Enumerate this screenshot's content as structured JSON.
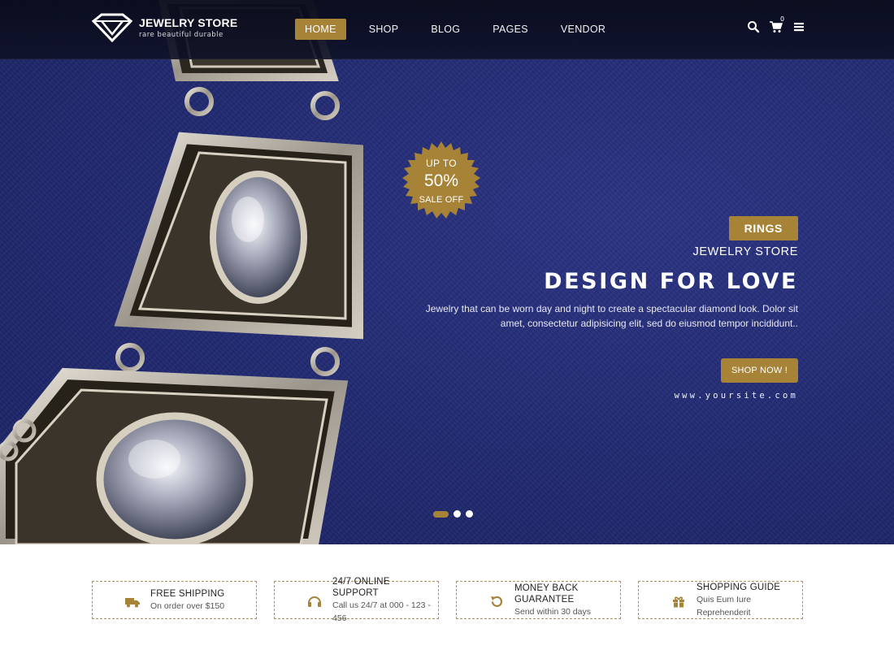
{
  "header": {
    "brand": "JEWELRY STORE",
    "tagline": "rare beautiful durable",
    "nav": [
      {
        "label": "HOME",
        "active": true
      },
      {
        "label": "SHOP",
        "active": false
      },
      {
        "label": "BLOG",
        "active": false
      },
      {
        "label": "PAGES",
        "active": false
      },
      {
        "label": "VENDOR",
        "active": false
      }
    ],
    "cart_count": "0",
    "icons": [
      "search-icon",
      "cart-icon",
      "menu-icon"
    ]
  },
  "hero": {
    "badge": {
      "line1": "UP TO",
      "line2": "50%",
      "line3": "SALE OFF"
    },
    "category_tag": "RINGS",
    "sub_brand": "JEWELRY STORE",
    "headline": "DESIGN FOR LOVE",
    "description_line1": "Jewelry that can be worn day and night to create a spectacular diamond look. Dolor sit",
    "description_line2": "amet, consectetur adipisicing elit, sed do eiusmod tempor incididunt..",
    "cta_label": "SHOP NOW !",
    "site_url": "www.yoursite.com",
    "slides": 3,
    "active_slide": 1
  },
  "features": [
    {
      "title": "FREE SHIPPING",
      "subtitle": "On order over $150",
      "icon": "truck-icon"
    },
    {
      "title": "24/7 ONLINE SUPPORT",
      "subtitle": "Call us 24/7 at 000 - 123 - 456",
      "icon": "headset-icon"
    },
    {
      "title": "MONEY BACK GUARANTEE",
      "subtitle": "Send within 30 days",
      "icon": "refresh-icon"
    },
    {
      "title": "SHOPPING GUIDE",
      "subtitle": "Quis Eum Iure Reprehenderit",
      "icon": "gift-icon"
    }
  ],
  "colors": {
    "accent": "#a68337",
    "hero_bg": "#222a73",
    "header_bg": "#0e1126"
  }
}
